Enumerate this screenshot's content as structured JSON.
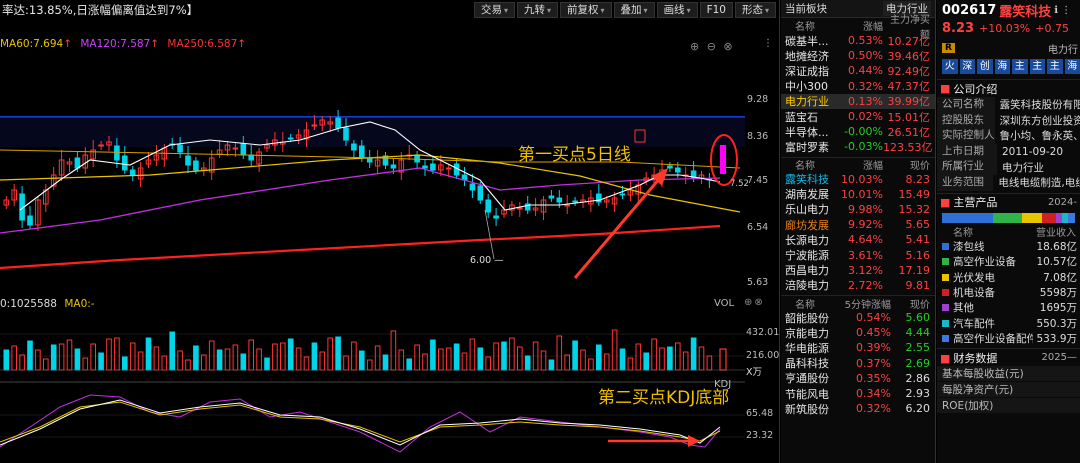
{
  "toolbar": {
    "formula_text": "率达:13.85%,日涨幅偏离值达到7%】",
    "buttons": [
      "交易",
      "九转",
      "前复权",
      "叠加",
      "画线",
      "F10",
      "形态"
    ]
  },
  "ma_legend": {
    "ma60": "MA60:7.694",
    "ma120": "MA120:7.587",
    "ma250": "MA250:6.587"
  },
  "price_axis": [
    "9.28",
    "8.36",
    "7.45",
    "6.54",
    "5.63"
  ],
  "price_marks": {
    "low_label": "6.00",
    "last_label": "7.52",
    "last_prefix": "7.1"
  },
  "annotations": {
    "buy1": "第一买点5日线",
    "buy2": "第二买点KDJ底部"
  },
  "vol_legend": {
    "vol": "0:1025588",
    "ma0": "MA0:-"
  },
  "vol_axis": [
    "432.01",
    "216.00"
  ],
  "vol_unit": "X万",
  "vol_title": "VOL",
  "kdj_title": "KDJ",
  "kdj_axis": [
    "65.48",
    "23.32"
  ],
  "pane_controls": "⊕ ⊖ ⊗",
  "sector": {
    "header_left": "当前板块",
    "header_right": "电力行业",
    "cols": [
      "名称",
      "涨幅",
      "主力净买额"
    ],
    "rows": [
      {
        "name": "碳基半...",
        "pct": "0.53%",
        "val": "10.27亿"
      },
      {
        "name": "地摊经济",
        "pct": "0.50%",
        "val": "39.46亿"
      },
      {
        "name": "深证成指",
        "pct": "0.44%",
        "val": "92.49亿"
      },
      {
        "name": "中小300",
        "pct": "0.32%",
        "val": "47.37亿"
      },
      {
        "name": "电力行业",
        "pct": "0.13%",
        "val": "39.99亿",
        "hl": true
      },
      {
        "name": "蓝宝石",
        "pct": "0.02%",
        "val": "15.01亿"
      },
      {
        "name": "半导体...",
        "pct": "-0.00%",
        "val": "26.51亿"
      },
      {
        "name": "富时罗素",
        "pct": "-0.03%",
        "val": "123.53亿"
      }
    ],
    "cols2": [
      "名称",
      "涨幅",
      "现价"
    ],
    "stocks": [
      {
        "name": "露笑科技",
        "pct": "10.03%",
        "val": "8.23",
        "c": "cyan"
      },
      {
        "name": "湖南发展",
        "pct": "10.01%",
        "val": "15.49"
      },
      {
        "name": "乐山电力",
        "pct": "9.98%",
        "val": "15.32"
      },
      {
        "name": "廊坊发展",
        "pct": "9.92%",
        "val": "5.65",
        "c": "org"
      },
      {
        "name": "长源电力",
        "pct": "4.64%",
        "val": "5.41"
      },
      {
        "name": "宁波能源",
        "pct": "3.61%",
        "val": "5.16"
      },
      {
        "name": "西昌电力",
        "pct": "3.12%",
        "val": "17.19"
      },
      {
        "name": "涪陵电力",
        "pct": "2.72%",
        "val": "9.81"
      }
    ],
    "cols3": [
      "名称",
      "5分钟涨幅",
      "现价"
    ],
    "stocks5": [
      {
        "name": "韶能股份",
        "pct": "0.54%",
        "val": "5.60"
      },
      {
        "name": "京能电力",
        "pct": "0.45%",
        "val": "4.44"
      },
      {
        "name": "华电能源",
        "pct": "0.39%",
        "val": "2.55"
      },
      {
        "name": "晶科科技",
        "pct": "0.37%",
        "val": "2.69"
      },
      {
        "name": "亨通股份",
        "pct": "0.35%",
        "val": "2.86"
      },
      {
        "name": "节能风电",
        "pct": "0.34%",
        "val": "2.93"
      },
      {
        "name": "新筑股份",
        "pct": "0.32%",
        "val": "6.20"
      }
    ]
  },
  "stock": {
    "code": "002617",
    "name": "露笑科技",
    "price": "8.23",
    "change": "+10.03%",
    "change_abs": "+0.75",
    "flag": "R",
    "industry_tag": "电力行",
    "chips": [
      "火",
      "深",
      "创",
      "海",
      "主",
      "主",
      "主",
      "海"
    ],
    "company_title": "公司介绍",
    "company": [
      {
        "k": "公司名称",
        "v": "露笑科技股份有限"
      },
      {
        "k": "控股股东",
        "v": "深圳东方创业投资"
      },
      {
        "k": "实际控制人",
        "v": "鲁小均、鲁永英、"
      },
      {
        "k": "上市日期",
        "v": "2011-09-20"
      },
      {
        "k": "所属行业",
        "v": "电力行业"
      },
      {
        "k": "业务范围",
        "v": "电线电缆制造,电线"
      }
    ],
    "products_title": "主营产品",
    "products_period": "2024-",
    "products_cols": [
      "名称",
      "营业收入"
    ],
    "products": [
      {
        "name": "漆包线",
        "val": "18.68亿",
        "color": "#2f6fd6",
        "share": 0.38
      },
      {
        "name": "高空作业设备",
        "val": "10.57亿",
        "color": "#2fb44a",
        "share": 0.22
      },
      {
        "name": "光伏发电",
        "val": "7.08亿",
        "color": "#e8c400",
        "share": 0.15
      },
      {
        "name": "机电设备",
        "val": "5598万",
        "color": "#d02020",
        "share": 0.11
      },
      {
        "name": "其他",
        "val": "1695万",
        "color": "#a040d0",
        "share": 0.04
      },
      {
        "name": "汽车配件",
        "val": "550.3万",
        "color": "#18b8c8",
        "share": 0.05
      },
      {
        "name": "高空作业设备配件",
        "val": "533.9万",
        "color": "#3a7ae0",
        "share": 0.05
      }
    ],
    "fin_title": "财务数据",
    "fin_period": "2025—",
    "fin_rows": [
      "基本每股收益(元)",
      "每股净资产(元)",
      "ROE(加权)"
    ]
  }
}
